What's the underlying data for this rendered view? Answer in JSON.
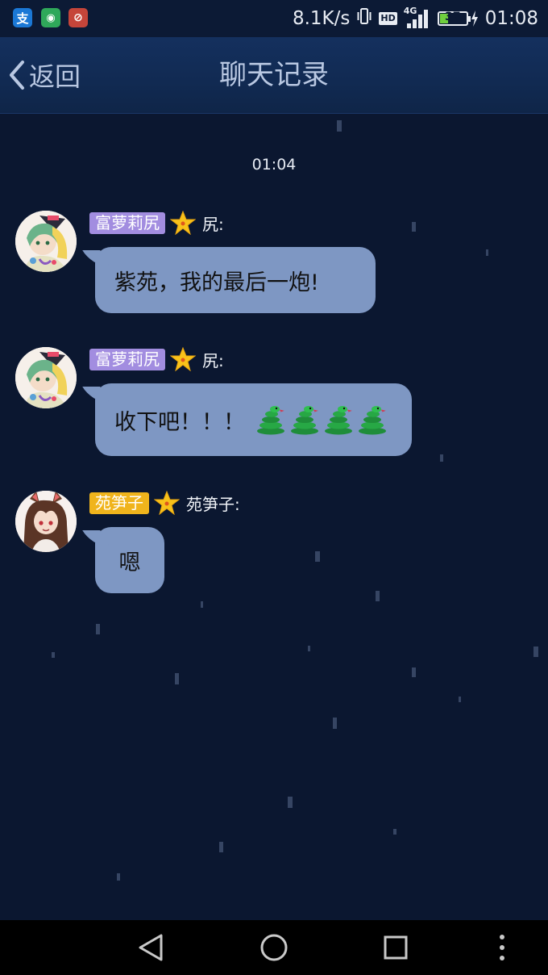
{
  "status_bar": {
    "network_speed": "8.1K/s",
    "hd_label": "HD",
    "network_type": "4G",
    "battery_level": "37",
    "battery_fraction": 0.37,
    "time": "01:08",
    "apps": [
      {
        "name": "alipay-icon",
        "glyph": "支",
        "color": "#1b78d6"
      },
      {
        "name": "green-app-icon",
        "glyph": "◉",
        "color": "#2fa85a"
      },
      {
        "name": "red-app-icon",
        "glyph": "⊘",
        "color": "#c5453a"
      }
    ]
  },
  "header": {
    "back_label": "返回",
    "title": "聊天记录"
  },
  "chat": {
    "timestamp": "01:04",
    "messages": [
      {
        "tag": "富萝莉尻",
        "tag_color": "#a28de0",
        "sender": "尻:",
        "text": "紫苑，我的最后一炮!",
        "emoji": []
      },
      {
        "tag": "富萝莉尻",
        "tag_color": "#a28de0",
        "sender": "尻:",
        "text": "收下吧！！！",
        "emoji": [
          "🐍",
          "🐍",
          "🐍",
          "🐍"
        ]
      },
      {
        "tag": "苑笋子",
        "tag_color": "#f0b41c",
        "sender": "苑笋子:",
        "text": "嗯",
        "emoji": []
      }
    ]
  },
  "colors": {
    "background": "#0b1730",
    "bubble": "#7e97c3",
    "title_text": "#b9c8e2"
  }
}
